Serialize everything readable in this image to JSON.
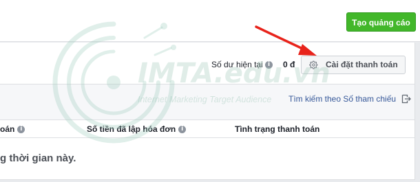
{
  "header": {
    "create_ad_label": "Tạo quảng cáo"
  },
  "balance": {
    "label": "Số dư hiện tại",
    "value": "0 đ",
    "info_icon_glyph": "i"
  },
  "payment_settings": {
    "label": "Cài đặt thanh toán",
    "icon": "gear-icon"
  },
  "search": {
    "link_label": "Tìm kiếm theo Số tham chiếu",
    "export_icon": "export-icon"
  },
  "table": {
    "columns": [
      {
        "label": "oán",
        "has_info": true
      },
      {
        "label": "Số tiền đã lập hóa đơn",
        "has_info": true
      },
      {
        "label": "Tình trạng thanh toán",
        "has_info": false
      }
    ],
    "empty_message": "g thời gian này."
  },
  "watermark": {
    "logo_text": "IMTA.edu.vn",
    "tagline": "Internet Marketing Target Audience"
  },
  "colors": {
    "create_ad_button": "#42b72a",
    "link": "#365899",
    "annotation_arrow": "#e8231b"
  }
}
